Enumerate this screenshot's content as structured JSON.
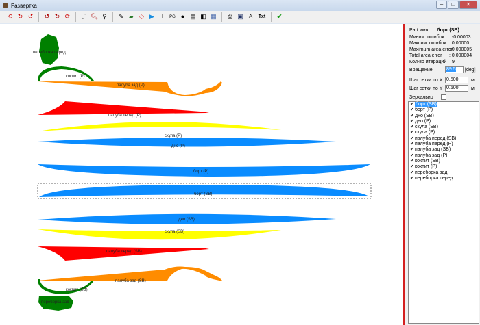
{
  "window": {
    "title": "Развертка",
    "min": "–",
    "max": "□",
    "close": "✕"
  },
  "toolbar": {
    "icons": [
      "rotate-left-red",
      "rotate-cw",
      "rotate-ccw",
      "rotate-a",
      "rotate-b",
      "rotate-c",
      "zoom-fit",
      "zoom-in",
      "zoom-out",
      "pen",
      "layers",
      "tag",
      "play",
      "dimension",
      "pg",
      "sphere",
      "film",
      "cube",
      "grid",
      "print",
      "save",
      "person",
      "txt",
      "check"
    ],
    "txt_label": "Txt"
  },
  "panel": {
    "part_name_label": "Part имя",
    "part_name": ": борт (SB)",
    "min_err_label": "Миним. ошибок",
    "min_err": ": -0.00003",
    "max_err_label": "Максим. ошибок",
    "max_err": ": 0.00000",
    "max_area_label": "Maximum area error",
    "max_area": ": 0.000005",
    "total_area_label": "Total area error",
    "total_area": ": 0.000004",
    "iter_label": "Кол-во итераций",
    "iter": "9",
    "rotation_label": "Вращение",
    "rotation": "89.5",
    "rotation_unit": "[deg]",
    "grid_x_label": "Шаг сетки по X",
    "grid_x": "0.500",
    "grid_x_unit": "м",
    "grid_y_label": "Шаг сетки по Y",
    "grid_y": "0.500",
    "grid_y_unit": "м",
    "mirror_label": "Зеркально",
    "parts": [
      {
        "label": "борт (SB)",
        "checked": true,
        "selected": true
      },
      {
        "label": "борт (P)",
        "checked": true
      },
      {
        "label": "дно (SB)",
        "checked": true
      },
      {
        "label": "дно (P)",
        "checked": true
      },
      {
        "label": "скула (SB)",
        "checked": true
      },
      {
        "label": "скула (P)",
        "checked": true
      },
      {
        "label": "палуба перед (SB)",
        "checked": true
      },
      {
        "label": "палуба перед (P)",
        "checked": true
      },
      {
        "label": "палуба зад (SB)",
        "checked": true
      },
      {
        "label": "палуба зад (P)",
        "checked": true
      },
      {
        "label": "кокпит (SB)",
        "checked": true
      },
      {
        "label": "кокпит (P)",
        "checked": true
      },
      {
        "label": "переборка зад",
        "checked": true
      },
      {
        "label": "переборка перед",
        "checked": true
      }
    ]
  },
  "canvas": {
    "labels": {
      "bh_front": "переборка перед",
      "cockpit_p": "кокпит (P)",
      "deck_rear_p": "палуба зад (P)",
      "deck_front_p": "палуба перед (P)",
      "chine_p": "скула (P)",
      "bottom_p": "дно (P)",
      "side_p": "борт (P)",
      "side_sb": "борт (SB)",
      "bottom_sb": "дно (SB)",
      "chine_sb": "скула (SB)",
      "deck_front_sb": "палуба перед (SB)",
      "deck_rear_sb": "палуба зад (SB)",
      "cockpit_sb": "кокпит (SB)",
      "bh_rear": "переборка зад"
    },
    "colors": {
      "green": "#008000",
      "orange": "#ff8c00",
      "red": "#ff0000",
      "yellow": "#ffff00",
      "blue": "#0a8cff"
    }
  }
}
